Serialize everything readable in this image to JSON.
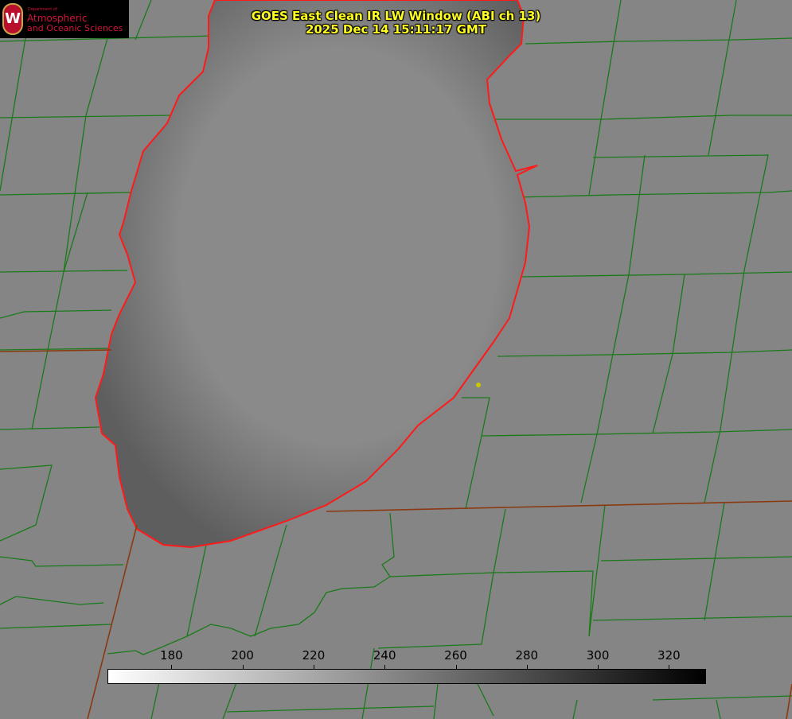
{
  "title": {
    "line1": "GOES East Clean IR LW Window (ABI ch 13)",
    "line2": "2025 Dec 14 15:11:17 GMT"
  },
  "logo": {
    "dept": "Department of",
    "line1": "Atmospheric",
    "line2": "and Oceanic Sciences",
    "mark": "W"
  },
  "colorbar": {
    "ticks": [
      "180",
      "200",
      "220",
      "240",
      "260",
      "280",
      "300",
      "320"
    ],
    "range": [
      162,
      330
    ],
    "colormap": "white-to-black"
  },
  "colors": {
    "county_lines": "#1a7a1a",
    "coastline": "#ff1a1a",
    "title": "#ffff20"
  }
}
